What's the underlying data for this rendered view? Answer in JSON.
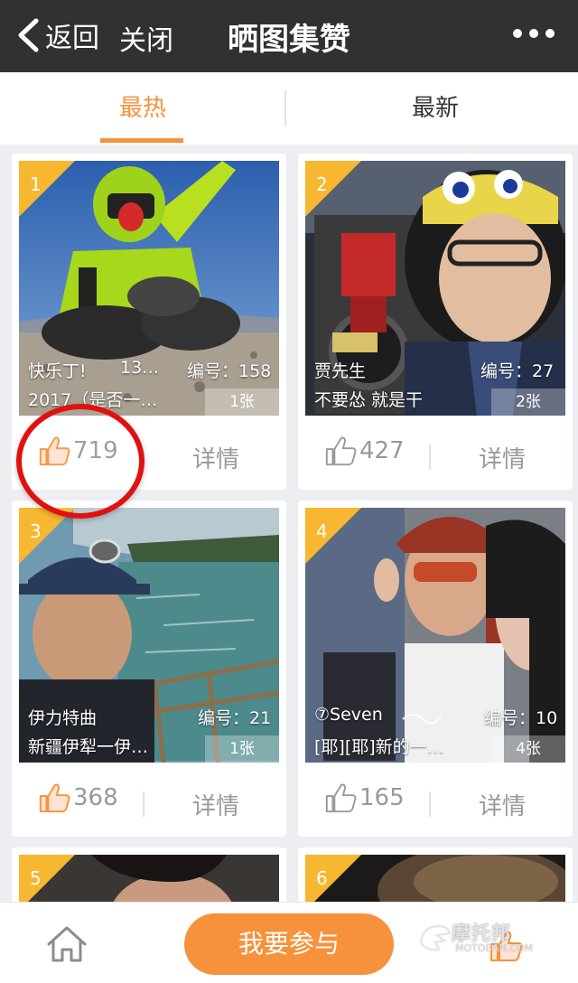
{
  "header": {
    "back_label": "返回",
    "close_label": "关闭",
    "title": "晒图集赞"
  },
  "tabs": [
    {
      "label": "最热",
      "active": true
    },
    {
      "label": "最新",
      "active": false
    }
  ],
  "cards": [
    {
      "rank": "1",
      "name": "快乐丁!",
      "name_extra": "13…",
      "id_text": "编号：158",
      "subtitle": "2017（是否一…",
      "photo_count": "1张",
      "likes": "719",
      "detail_label": "详情"
    },
    {
      "rank": "2",
      "name": "贾先生",
      "name_extra": "",
      "id_text": "编号：27",
      "subtitle": "不要怂 就是干",
      "photo_count": "2张",
      "likes": "427",
      "detail_label": "详情"
    },
    {
      "rank": "3",
      "name": "伊力特曲",
      "name_extra": "",
      "id_text": "编号：21",
      "subtitle": "新疆伊犁一伊…",
      "photo_count": "1张",
      "likes": "368",
      "detail_label": "详情"
    },
    {
      "rank": "4",
      "name": "⑦Seven",
      "name_extra": "",
      "id_text": "编号：10",
      "subtitle": "[耶][耶]新的一…",
      "photo_count": "4张",
      "likes": "165",
      "detail_label": "详情"
    },
    {
      "rank": "5"
    },
    {
      "rank": "6"
    }
  ],
  "bottom": {
    "join_label": "我要参与",
    "watermark": "摩托邦",
    "watermark_sub": "MOTOBAN.COM"
  },
  "colors": {
    "accent": "#f5923b",
    "corner": "#f7b731",
    "header_bg": "#2f3133",
    "highlight": "#e01111"
  }
}
